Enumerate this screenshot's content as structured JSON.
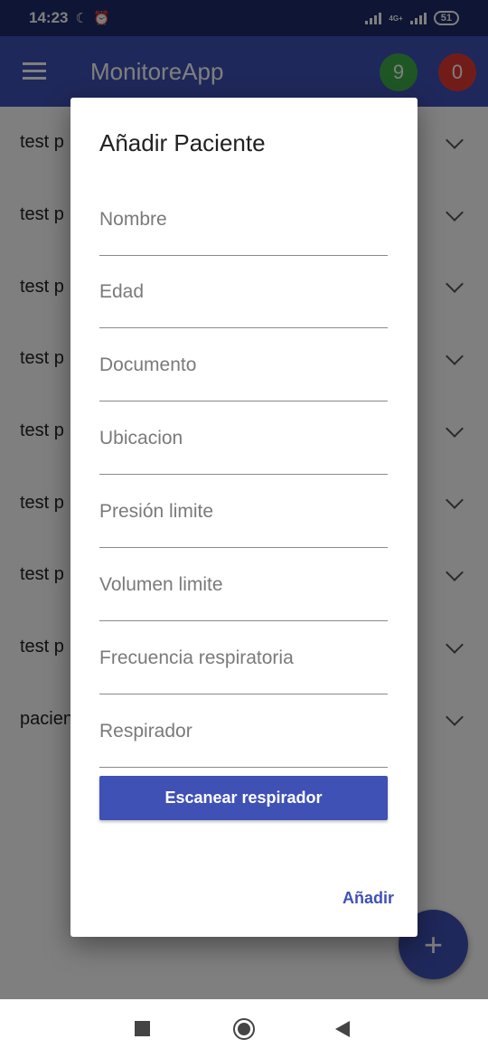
{
  "status_bar": {
    "time": "14:23",
    "battery": "51",
    "network": "4G+"
  },
  "app_bar": {
    "title": "MonitoreApp",
    "badge_green": "9",
    "badge_red": "0",
    "badge_green_color": "#3fae49",
    "badge_red_color": "#e53935"
  },
  "list": {
    "items": [
      {
        "label": "test p"
      },
      {
        "label": "test p"
      },
      {
        "label": "test p"
      },
      {
        "label": "test p"
      },
      {
        "label": "test p"
      },
      {
        "label": "test p"
      },
      {
        "label": "test p"
      },
      {
        "label": "test p"
      },
      {
        "label": "pacien"
      }
    ]
  },
  "fab": {
    "label": "+"
  },
  "dialog": {
    "title": "Añadir Paciente",
    "fields": {
      "nombre": "Nombre",
      "edad": "Edad",
      "documento": "Documento",
      "ubicacion": "Ubicacion",
      "presion": "Presión limite",
      "volumen": "Volumen limite",
      "frecuencia": "Frecuencia respiratoria",
      "respirador": "Respirador"
    },
    "scan_button": "Escanear respirador",
    "add_button": "Añadir"
  },
  "colors": {
    "primary": "#3f51b5",
    "status_bar": "#1e2a6a"
  }
}
